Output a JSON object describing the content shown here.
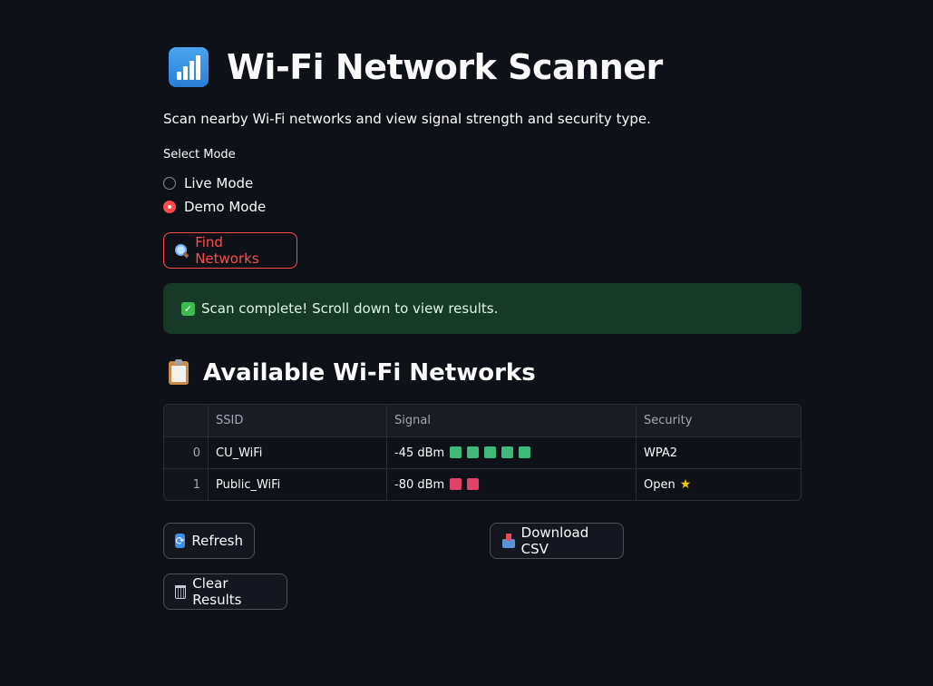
{
  "header": {
    "title": "Wi-Fi Network Scanner",
    "title_icon": "bar-chart-icon",
    "subtitle": "Scan nearby Wi-Fi networks and view signal strength and security type."
  },
  "mode": {
    "label": "Select Mode",
    "options": [
      "Live Mode",
      "Demo Mode"
    ],
    "selected": "Demo Mode"
  },
  "actions": {
    "find_label": "Find Networks",
    "refresh_label": "Refresh",
    "download_label": "Download CSV",
    "clear_label": "Clear Results"
  },
  "status": {
    "message": "Scan complete! Scroll down to view results."
  },
  "results": {
    "title": "Available Wi-Fi Networks",
    "columns": [
      "",
      "SSID",
      "Signal",
      "Security"
    ],
    "rows": [
      {
        "index": "0",
        "ssid": "CU_WiFi",
        "signal_text": "-45 dBm",
        "bars": 5,
        "bar_color": "#3fb97a",
        "security": "WPA2",
        "security_icon": ""
      },
      {
        "index": "1",
        "ssid": "Public_WiFi",
        "signal_text": "-80 dBm",
        "bars": 2,
        "bar_color": "#e0436a",
        "security": "Open",
        "security_icon": "star-icon"
      }
    ]
  },
  "colors": {
    "accent": "#ff4b4b",
    "background": "#0e1117",
    "success_bg": "#173928"
  }
}
